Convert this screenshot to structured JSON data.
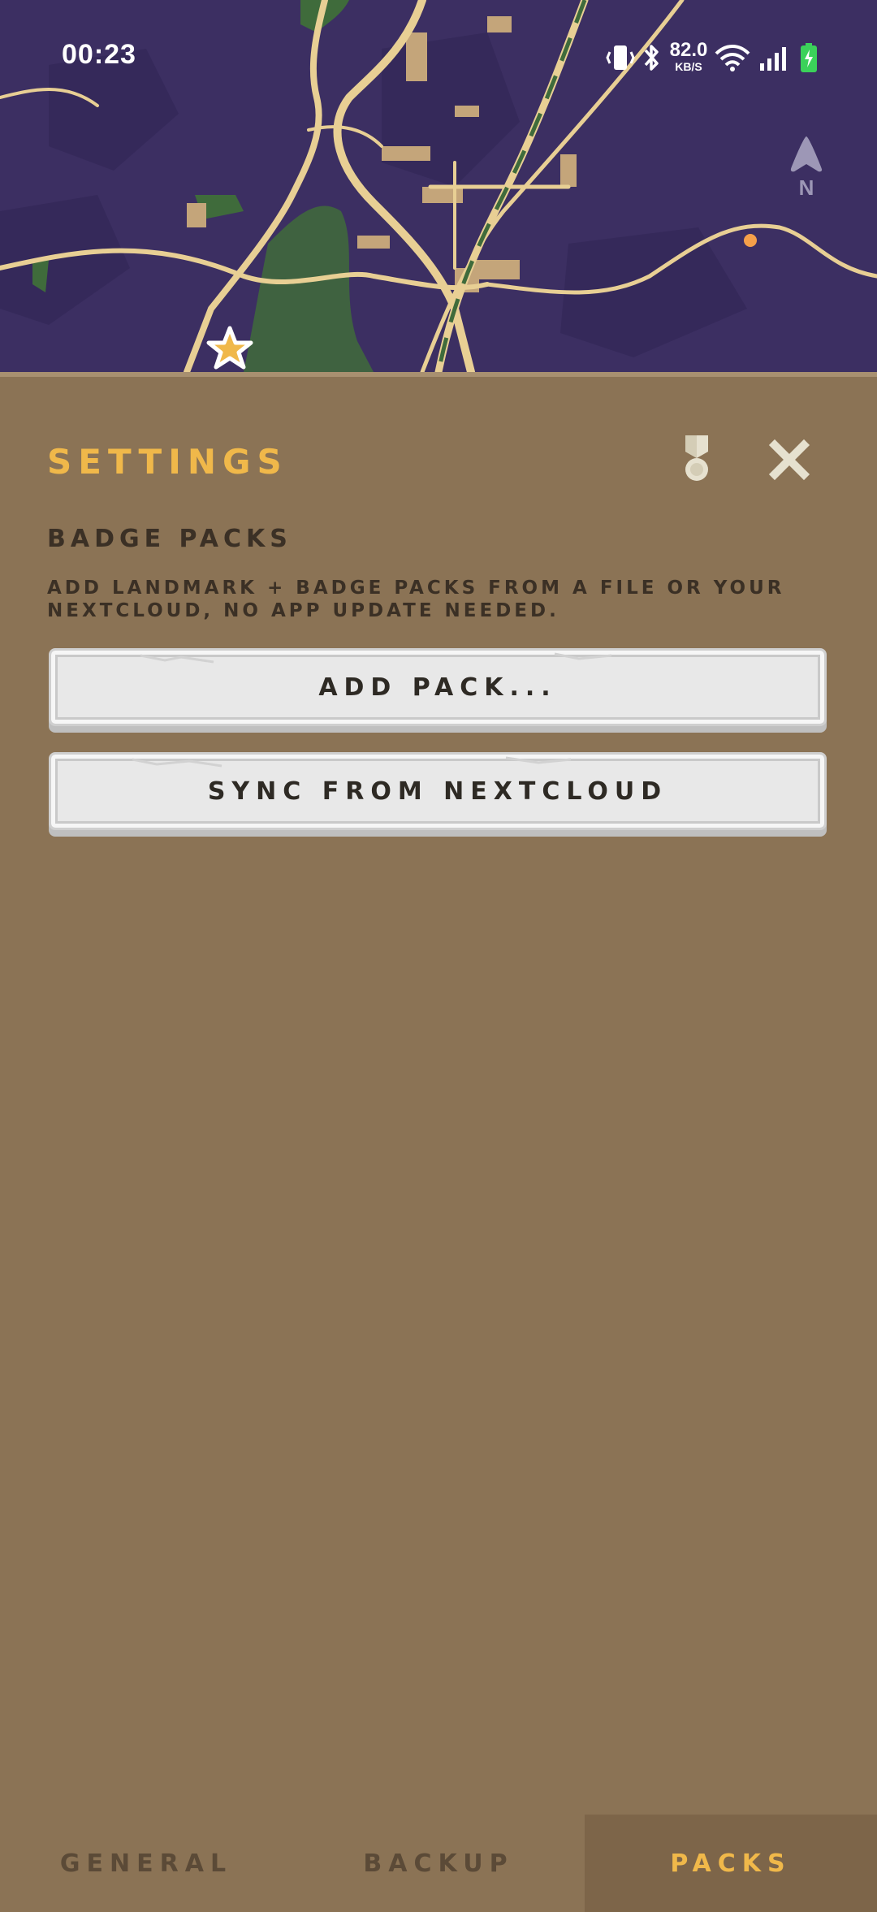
{
  "status_bar": {
    "time": "00:23",
    "speed_value": "82.0",
    "speed_unit": "KB/S",
    "icons": [
      "vibrate-icon",
      "bluetooth-icon",
      "wifi-icon",
      "cell-signal-icon",
      "battery-charging-icon"
    ]
  },
  "map": {
    "compass_label": "N",
    "colors": {
      "background": "#3c2f62",
      "road": "#e8cf94",
      "land": "#c4a57a",
      "green": "#3f6b3b",
      "marker_orange": "#f5a04a",
      "star": "#f0b84a"
    }
  },
  "panel": {
    "title": "SETTINGS",
    "badge_icon": "medal-icon",
    "close_icon": "close-icon",
    "section": {
      "heading": "BADGE PACKS",
      "description": "Add landmark + badge packs from a file or your Nextcloud, no app update needed."
    },
    "buttons": {
      "add_pack": "ADD PACK...",
      "sync_nextcloud": "SYNC FROM NEXTCLOUD"
    }
  },
  "tabs": [
    {
      "label": "GENERAL",
      "active": false
    },
    {
      "label": "BACKUP",
      "active": false
    },
    {
      "label": "PACKS",
      "active": true
    }
  ],
  "colors": {
    "panel_bg": "#8b7355",
    "accent": "#f0b84a",
    "text_dark": "#3b3025",
    "tab_active_bg": "#7d6549"
  }
}
